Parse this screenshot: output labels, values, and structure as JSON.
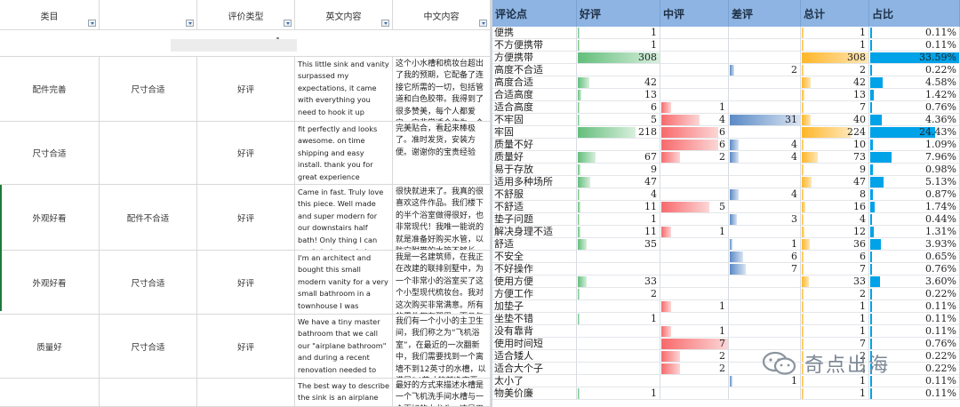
{
  "left_sheet": {
    "headers": [
      "类目",
      "",
      "评价类型",
      "英文内容",
      "中文内容"
    ],
    "rows": [
      {
        "cat": "配件完善",
        "sub": "尺寸合适",
        "type": "好评",
        "en": "This little sink and vanity surpassed my expectations, it came with everything you need to hook it up including the plumbing and white tape I have gotten so many",
        "zh": "这个小水槽和梳妆台超出了我的预期，它配备了连接它所需的一切，包括管道和白色胶带。我得到了很多赞美，每个人都爱它。它非常适合作为一个小浴室"
      },
      {
        "cat": "尺寸合适",
        "sub": "",
        "type": "好评",
        "en": "fit perfectly and looks awesome. on time shipping and easy install. thank you for great experience",
        "zh": "完美贴合，看起来棒极了。准时发货，安装方便。谢谢你的宝贵经验"
      },
      {
        "cat": "外观好看",
        "sub": "配件不合适",
        "type": "好评",
        "en": "Came in fast. Truly love this piece. Well made and super modern for our downstairs half bath! Only thing I can say is to be ready to purchase plumbing pipes in case the",
        "zh": "很快就进来了。我真的很喜欢这件作品。我们楼下的半个浴室做得很好，也非常现代！我唯一能说的就是准备好购买水管，以防它附带的水管不够长。我买了新的/可调节的长度，价格不贵，效果"
      },
      {
        "cat": "外观好看",
        "sub": "尺寸合适",
        "type": "好评",
        "en": "I'm an architect and bought this small modern vanity for a very small bathroom in a townhouse I was remodeling. I was extremely satisfied with this purchase. All the parts",
        "zh": "我是一名建筑师，在我正在改建的联排别墅中，为一个非常小的浴室买了这个小型现代梳妆台。我对这次购买非常满意。所有的零件都在那里，而且包装很好。白色的外观是高光泽的白色，与"
      },
      {
        "cat": "质量好",
        "sub": "尺寸合适",
        "type": "好评",
        "en": "We have a tiny master bathroom that we call our \"airplane bathroom\" and during a recent renovation needed to find a sink that was less than 12\" off the wall to",
        "zh": "我们有一个小小的主卫生间，我们称之为“飞机浴室”，在最近的一次翻新中，我们需要找到一个离墙不到12英寸的水槽，以满足24英寸的前净空要求。这个可以"
      },
      {
        "cat": "",
        "sub": "",
        "type": "",
        "en": "The best way to describe the sink is an airplane washroom sink with a much better",
        "zh": "最好的方式来描述水槽是一个飞机洗手间水槽与一个更好的水龙头。这是用来替换"
      }
    ]
  },
  "right_sheet": {
    "headers": [
      "评论点",
      "好评",
      "中评",
      "差评",
      "总计",
      "占比"
    ],
    "rows": [
      {
        "name": "便携",
        "good": 1,
        "mid": null,
        "bad": null,
        "total": 1,
        "pct": "0.11%"
      },
      {
        "name": "不方便携带",
        "good": 1,
        "mid": null,
        "bad": null,
        "total": 1,
        "pct": "0.11%"
      },
      {
        "name": "方便携带",
        "good": 308,
        "mid": null,
        "bad": null,
        "total": 308,
        "pct": "33.59%"
      },
      {
        "name": "高度不合适",
        "good": null,
        "mid": null,
        "bad": 2,
        "total": 2,
        "pct": "0.22%"
      },
      {
        "name": "高度合适",
        "good": 42,
        "mid": null,
        "bad": null,
        "total": 42,
        "pct": "4.58%"
      },
      {
        "name": "合适高度",
        "good": 13,
        "mid": null,
        "bad": null,
        "total": 13,
        "pct": "1.42%"
      },
      {
        "name": "适合高度",
        "good": 6,
        "mid": 1,
        "bad": null,
        "total": 7,
        "pct": "0.76%"
      },
      {
        "name": "不牢固",
        "good": 5,
        "mid": 4,
        "bad": 31,
        "total": 40,
        "pct": "4.36%"
      },
      {
        "name": "牢固",
        "good": 218,
        "mid": 6,
        "bad": null,
        "total": 224,
        "pct": "24.43%"
      },
      {
        "name": "质量不好",
        "good": null,
        "mid": 6,
        "bad": 4,
        "total": 10,
        "pct": "1.09%"
      },
      {
        "name": "质量好",
        "good": 67,
        "mid": 2,
        "bad": 4,
        "total": 73,
        "pct": "7.96%"
      },
      {
        "name": "易于存放",
        "good": 9,
        "mid": null,
        "bad": null,
        "total": 9,
        "pct": "0.98%"
      },
      {
        "name": "适用多种场所",
        "good": 47,
        "mid": null,
        "bad": null,
        "total": 47,
        "pct": "5.13%"
      },
      {
        "name": "不舒服",
        "good": 4,
        "mid": null,
        "bad": 4,
        "total": 8,
        "pct": "0.87%"
      },
      {
        "name": "不舒适",
        "good": 11,
        "mid": 5,
        "bad": null,
        "total": 16,
        "pct": "1.74%"
      },
      {
        "name": "垫子问题",
        "good": 1,
        "mid": null,
        "bad": 3,
        "total": 4,
        "pct": "0.44%"
      },
      {
        "name": "解决身理不适",
        "good": 11,
        "mid": 1,
        "bad": null,
        "total": 12,
        "pct": "1.31%"
      },
      {
        "name": "舒适",
        "good": 35,
        "mid": null,
        "bad": 1,
        "total": 36,
        "pct": "3.93%"
      },
      {
        "name": "不安全",
        "good": null,
        "mid": null,
        "bad": 6,
        "total": 6,
        "pct": "0.65%"
      },
      {
        "name": "不好操作",
        "good": null,
        "mid": null,
        "bad": 7,
        "total": 7,
        "pct": "0.76%"
      },
      {
        "name": "使用方便",
        "good": 33,
        "mid": null,
        "bad": null,
        "total": 33,
        "pct": "3.60%"
      },
      {
        "name": "方便工作",
        "good": 2,
        "mid": null,
        "bad": null,
        "total": 2,
        "pct": "0.22%"
      },
      {
        "name": "加垫子",
        "good": null,
        "mid": 1,
        "bad": null,
        "total": 1,
        "pct": "0.11%"
      },
      {
        "name": "坐垫不错",
        "good": 1,
        "mid": null,
        "bad": null,
        "total": 1,
        "pct": "0.11%"
      },
      {
        "name": "没有靠背",
        "good": null,
        "mid": 1,
        "bad": null,
        "total": 1,
        "pct": "0.11%"
      },
      {
        "name": "使用时间短",
        "good": null,
        "mid": 7,
        "bad": null,
        "total": 7,
        "pct": "0.76%"
      },
      {
        "name": "适合矮人",
        "good": null,
        "mid": 2,
        "bad": null,
        "total": 2,
        "pct": "0.22%"
      },
      {
        "name": "适合大个子",
        "good": null,
        "mid": 2,
        "bad": null,
        "total": 2,
        "pct": "0.22%"
      },
      {
        "name": "太小了",
        "good": null,
        "mid": null,
        "bad": 1,
        "total": 1,
        "pct": "0.11%"
      },
      {
        "name": "物美价廉",
        "good": 1,
        "mid": null,
        "bad": null,
        "total": 1,
        "pct": "0.11%"
      }
    ]
  },
  "watermark": {
    "text": "奇点出海",
    "icon": "wechat-icon"
  },
  "colors": {
    "header_blue": "#8db4e2",
    "good_green": "#63be7b",
    "mid_red": "#f8696b",
    "bad_blue": "#5a8ac6",
    "total_orange": "#ffb628",
    "pct_cyan": "#00a2e8"
  }
}
